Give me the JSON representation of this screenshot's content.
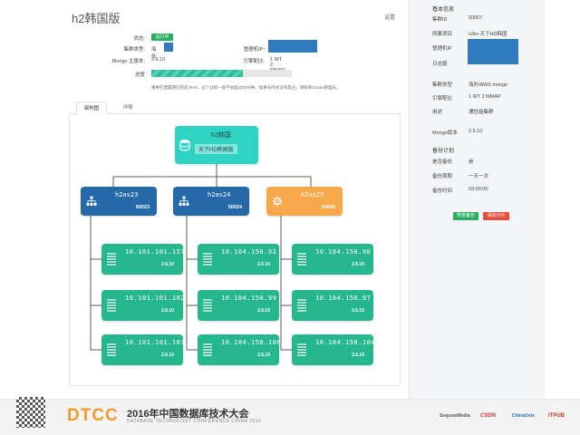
{
  "header": {
    "title": "h2韩国版",
    "settings_label": "设置"
  },
  "info": {
    "status_label": "状态:",
    "status_value": "运行中",
    "cluster_type_label": "集群类型:",
    "cluster_type_value": "海外",
    "mongo_version_label": "Mongo 主版本:",
    "mongo_version_value": "2.6.10",
    "admin_ip_label": "管理机IP:",
    "engine_label": "引擎配比:",
    "engine_value": "1 WT 2 MMAP",
    "progress_label": "进度",
    "progress_fraction": 0.65,
    "progress_note": "重要在建置期已完成 80%。这个过程一般不会超过30分钟。如果长时间没有反应，请联系Ocean管理员。"
  },
  "tabs": [
    {
      "label": "架构图"
    },
    {
      "label": "详情"
    }
  ],
  "diagram": {
    "root": {
      "name": "h2韩国",
      "label": "天下HD韩国版"
    },
    "shards": [
      {
        "name": "h2as23",
        "port": "50023"
      },
      {
        "name": "h2as24",
        "port": "50024"
      },
      {
        "name": "h2as25",
        "port": "50025"
      }
    ],
    "replicas": [
      [
        {
          "ip": "10.101.101.157",
          "version": "2.6.10"
        },
        {
          "ip": "10.101.101.162",
          "version": "2.6.10"
        },
        {
          "ip": "10.101.101.167",
          "version": "2.6.10"
        }
      ],
      [
        {
          "ip": "10.104.150.92",
          "version": "2.6.10"
        },
        {
          "ip": "10.104.150.99",
          "version": "2.6.10"
        },
        {
          "ip": "10.104.150.106",
          "version": "2.6.10"
        }
      ],
      [
        {
          "ip": "10.104.150.90",
          "version": "2.6.10"
        },
        {
          "ip": "10.104.150.97",
          "version": "2.6.10"
        },
        {
          "ip": "10.104.150.104",
          "version": "2.6.10"
        }
      ]
    ]
  },
  "sidebar": {
    "basic_heading": "基本信息",
    "cluster_id_label": "集群ID",
    "cluster_id_value": "50007",
    "project_label": "所属项目",
    "project_value": "n2kr-天下HD韩国",
    "admin_ip_label": "管理机IP",
    "log_label": "日志服",
    "cluster_type_label": "集群类型",
    "cluster_type_value": "海外/AWS mongo",
    "engine_label": "引擎配比",
    "engine_value": "1 WT 2 MMAP",
    "usage_label": "用途",
    "usage_value": "通性能集群",
    "mongo_version_label": "Mongo版本",
    "mongo_version_value": "2.6.10",
    "backup_heading": "备份计划",
    "backup_enabled_label": "是否备份",
    "backup_enabled_value": "是",
    "backup_cycle_label": "备份周期",
    "backup_cycle_value": "一天一次",
    "backup_time_label": "备份时间",
    "backup_time_value": "03:00:00",
    "restore_button": "恢复备份",
    "add_shard_button": "添加分片"
  },
  "footer": {
    "logo": "DTCC",
    "title_cn": "2016年中国数据库技术大会",
    "title_en": "DATABASE TECHNOLOGY CONFERENCE CHINA 2016",
    "sponsors": [
      "SequoiaMedia",
      "CSDN",
      "ChinaUnix",
      "ITPUB"
    ]
  },
  "colors": {
    "accent": "#2fd3c4",
    "shard": "#2569a8",
    "shard_alt": "#f7a84b",
    "replica": "#27b78f"
  }
}
